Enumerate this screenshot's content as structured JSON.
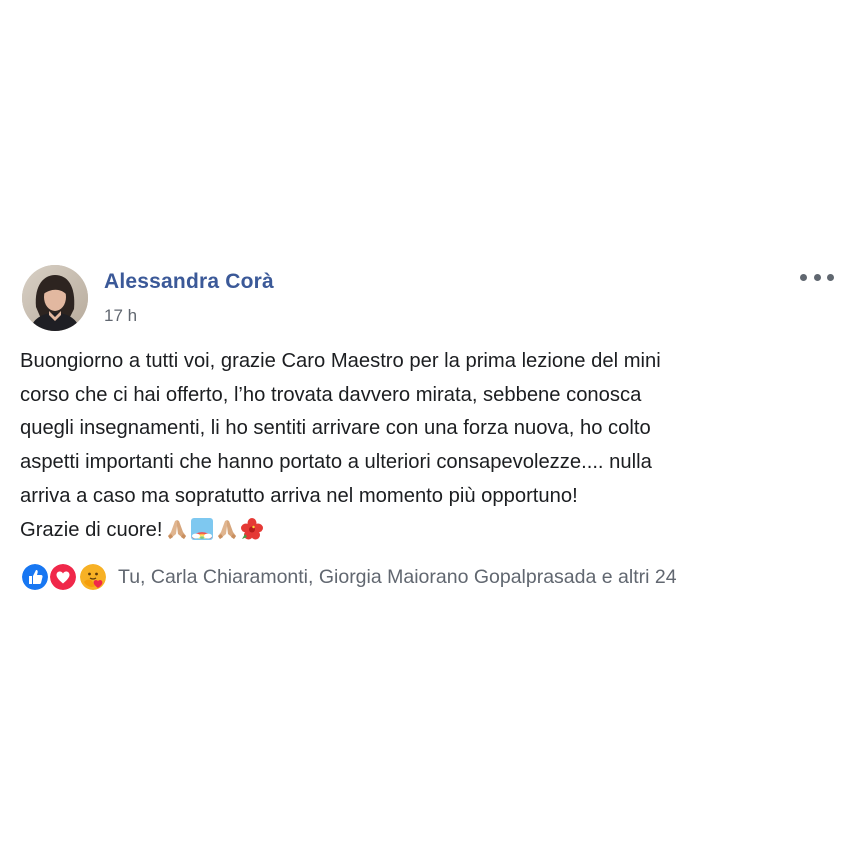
{
  "post": {
    "author": "Alessandra Corà",
    "timestamp": "17 h",
    "body_lines": [
      "Buongiorno a tutti voi, grazie Caro Maestro per la prima lezione del mini",
      "corso che ci hai offerto, l’ho trovata davvero mirata, sebbene conosca",
      "quegli insegnamenti, li ho sentiti arrivare con una forza nuova, ho colto",
      "aspetti importanti che hanno portato a ulteriori consapevolezze.... nulla",
      "arriva a caso ma sopratutto arriva nel momento più opportuno!",
      "Grazie di cuore!"
    ],
    "trailing_emojis": [
      "folded-hands",
      "rainbow",
      "folded-hands",
      "hibiscus"
    ]
  },
  "reactions": {
    "icons": [
      "like",
      "love",
      "care"
    ],
    "summary": "Tu, Carla Chiaramonti, Giorgia Maiorano Gopalprasada e altri 24"
  },
  "colors": {
    "author_link": "#3b5998",
    "meta_text": "#616770",
    "body_text": "#1c1e21",
    "like_blue": "#1877f2",
    "love_red": "#f0284a",
    "care_yellow": "#f7b125"
  },
  "icons": {
    "more_options": "three-dots-horizontal-icon"
  }
}
